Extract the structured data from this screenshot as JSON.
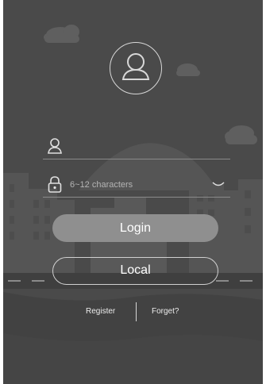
{
  "login_form": {
    "username_value": "",
    "password_placeholder": "6~12 characters",
    "login_label": "Login",
    "local_label": "Local"
  },
  "links": {
    "register_label": "Register",
    "forgot_label": "Forget?"
  },
  "icons": {
    "avatar": "user-avatar-icon",
    "username": "user-icon",
    "password": "lock-icon",
    "visibility": "eye-closed-icon"
  },
  "colors": {
    "background": "#4a4a4a",
    "login_button": "#8f8f8f",
    "outline": "#d0d0d0"
  }
}
